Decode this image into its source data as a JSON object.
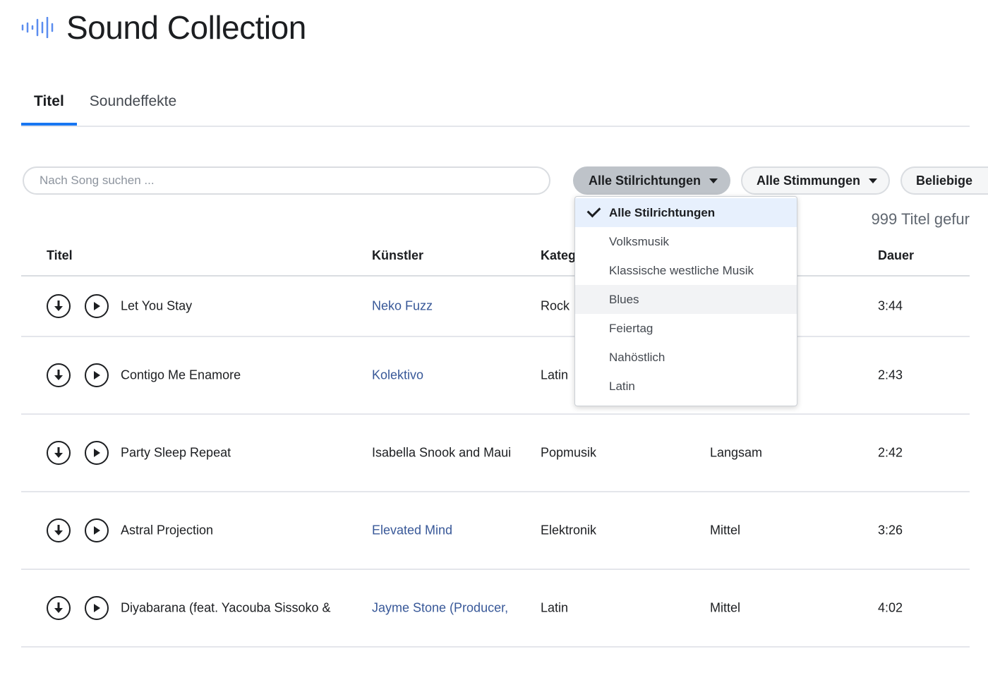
{
  "app": {
    "title": "Sound Collection",
    "logo_icon": "audio-wave-icon",
    "accent": "#1877f2"
  },
  "tabs": [
    {
      "label": "Titel",
      "active": true
    },
    {
      "label": "Soundeffekte",
      "active": false
    }
  ],
  "search": {
    "placeholder": "Nach Song suchen ...",
    "value": ""
  },
  "filters": [
    {
      "label": "Alle Stilrichtungen",
      "open": true
    },
    {
      "label": "Alle Stimmungen",
      "open": false
    },
    {
      "label": "Beliebige"
    }
  ],
  "result_count": "999 Titel gefur",
  "dropdown": {
    "items": [
      {
        "label": "Alle Stilrichtungen",
        "selected": true
      },
      {
        "label": "Volksmusik"
      },
      {
        "label": "Klassische westliche Musik"
      },
      {
        "label": "Blues",
        "hover": true
      },
      {
        "label": "Feiertag"
      },
      {
        "label": "Nahöstlich"
      },
      {
        "label": "Latin"
      }
    ]
  },
  "table": {
    "headers": {
      "title": "Titel",
      "artist": "Künstler",
      "category": "Kateg",
      "duration": "Dauer"
    },
    "rows": [
      {
        "title": "Let You Stay",
        "artist": "Neko Fuzz",
        "artist_link": true,
        "category": "Rock",
        "tempo": "",
        "duration": "3:44"
      },
      {
        "title": "Contigo Me Enamore",
        "artist": "Kolektivo",
        "artist_link": true,
        "category": "Latin",
        "tempo": "",
        "duration": "2:43"
      },
      {
        "title": "Party Sleep Repeat",
        "artist": "Isabella Snook and Maui",
        "artist_link": false,
        "category": "Popmusik",
        "tempo": "Langsam",
        "duration": "2:42"
      },
      {
        "title": "Astral Projection",
        "artist": "Elevated Mind",
        "artist_link": true,
        "category": "Elektronik",
        "tempo": "Mittel",
        "duration": "3:26"
      },
      {
        "title": "Diyabarana (feat. Yacouba Sissoko &",
        "artist": "Jayme Stone (Producer,",
        "artist_link": true,
        "category": "Latin",
        "tempo": "Mittel",
        "duration": "4:02"
      }
    ]
  }
}
